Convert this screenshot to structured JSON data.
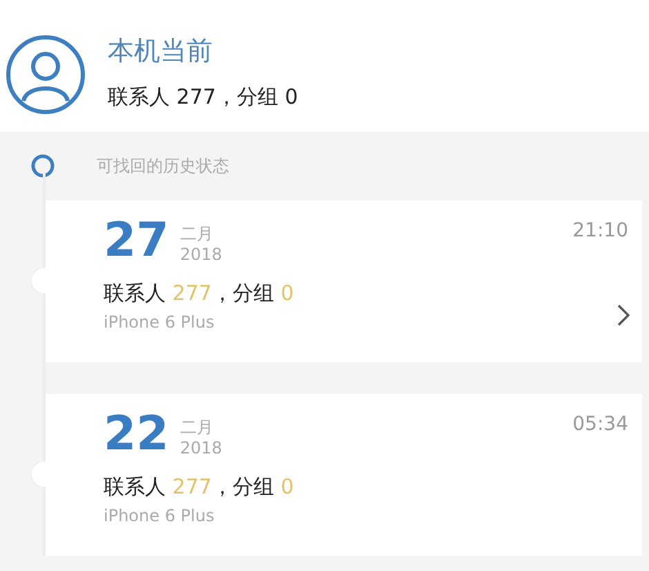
{
  "current": {
    "title": "本机当前",
    "contacts_label": "联系人",
    "contacts": "277",
    "groups_label": "，分组",
    "groups": "0"
  },
  "section_label": "可找回的历史状态",
  "records": [
    {
      "day": "27",
      "month": "二月",
      "year": "2018",
      "time": "21:10",
      "contacts_label": "联系人",
      "contacts": "277",
      "groups_label": "，分组",
      "groups": "0",
      "device": "iPhone 6 Plus",
      "chevron": true
    },
    {
      "day": "22",
      "month": "二月",
      "year": "2018",
      "time": "05:34",
      "contacts_label": "联系人",
      "contacts": "277",
      "groups_label": "，分组",
      "groups": "0",
      "device": "iPhone 6 Plus",
      "chevron": false
    }
  ]
}
